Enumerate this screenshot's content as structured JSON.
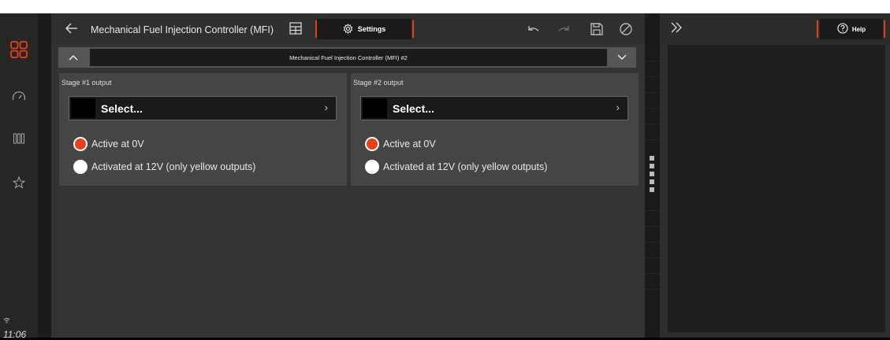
{
  "sidebar": {
    "time": "11:06",
    "items": [
      {
        "icon": "grid-squares-icon",
        "active": true
      },
      {
        "icon": "gauge-icon"
      },
      {
        "icon": "columns-icon"
      },
      {
        "icon": "star-icon"
      }
    ]
  },
  "toolbar": {
    "title": "Mechanical Fuel Injection Controller (MFI)",
    "settings_label": "Settings"
  },
  "module": {
    "name": "Mechanical Fuel Injection Controller (MFI) #2"
  },
  "stages": [
    {
      "title": "Stage #1 output",
      "select_placeholder": "Select...",
      "options": [
        {
          "label": "Active at 0V",
          "selected": true
        },
        {
          "label": "Activated at 12V (only yellow outputs)",
          "selected": false
        }
      ]
    },
    {
      "title": "Stage #2 output",
      "select_placeholder": "Select...",
      "options": [
        {
          "label": "Active at 0V",
          "selected": true
        },
        {
          "label": "Activated at 12V (only yellow outputs)",
          "selected": false
        }
      ]
    }
  ],
  "right_pane": {
    "help_label": "Help"
  },
  "colors": {
    "accent": "#e8401a",
    "panel": "#454545",
    "background": "#333333"
  }
}
